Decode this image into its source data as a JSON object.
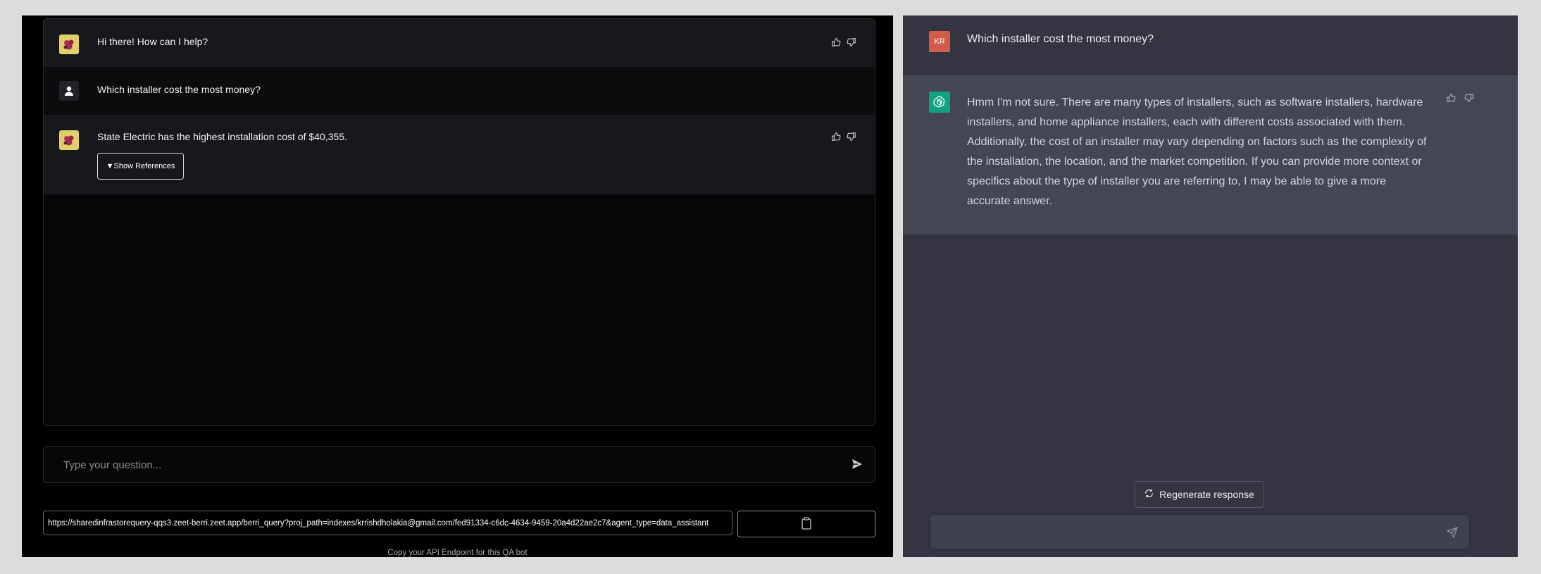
{
  "left_chat": {
    "messages": [
      {
        "role": "bot",
        "text": "Hi there! How can I help?"
      },
      {
        "role": "user",
        "text": "Which installer cost the most money?"
      },
      {
        "role": "bot",
        "text": "State Electric has the highest installation cost of $40,355."
      }
    ],
    "show_references_label": "▼Show References",
    "input_placeholder": "Type your question...",
    "api_endpoint": "https://sharedinfrastorequery-qqs3.zeet-berri.zeet.app/berri_query?proj_path=indexes/krrishdholakia@gmail.com/fed91334-c6dc-4634-9459-20a4d22ae2c7&agent_type=data_assistant",
    "api_caption": "Copy your API Endpoint for this QA bot"
  },
  "right_chat": {
    "user_initials": "KR",
    "user_message": "Which installer cost the most money?",
    "assistant_message": "Hmm I'm not sure. There are many types of installers, such as software installers, hardware installers, and home appliance installers, each with different costs associated with them. Additionally, the cost of an installer may vary depending on factors such as the complexity of the installation, the location, and the market competition. If you can provide more context or specifics about the type of installer you are referring to, I may be able to give a more accurate answer.",
    "regenerate_label": "Regenerate response"
  },
  "colors": {
    "left_bg": "#000000",
    "right_bg": "#343541",
    "assistant_row_bg": "#444654",
    "gpt_icon": "#10a37f",
    "user_avatar": "#d35b4a"
  },
  "icons": [
    "bot-avatar-icon",
    "user-avatar-icon",
    "thumbs-up-icon",
    "thumbs-down-icon",
    "send-icon",
    "clipboard-icon",
    "openai-logo-icon",
    "refresh-icon",
    "paper-plane-icon"
  ]
}
